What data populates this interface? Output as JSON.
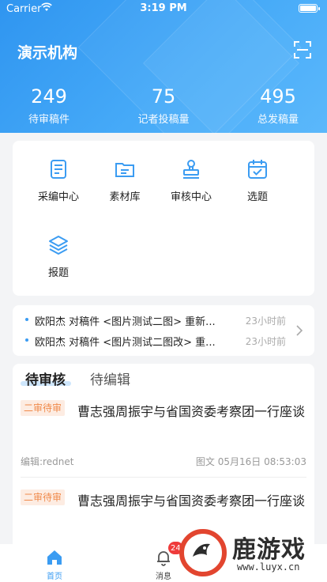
{
  "status_bar": {
    "carrier": "Carrier",
    "time": "3:19 PM"
  },
  "header": {
    "title": "演示机构",
    "stats": [
      {
        "value": "249",
        "label": "待审稿件"
      },
      {
        "value": "75",
        "label": "记者投稿量"
      },
      {
        "value": "495",
        "label": "总发稿量"
      }
    ]
  },
  "menu": [
    {
      "label": "采编中心",
      "icon": "document-icon"
    },
    {
      "label": "素材库",
      "icon": "folder-icon"
    },
    {
      "label": "审核中心",
      "icon": "stamp-icon"
    },
    {
      "label": "选题",
      "icon": "calendar-icon"
    },
    {
      "label": "报题",
      "icon": "layers-icon"
    }
  ],
  "news": [
    {
      "text": "欧阳杰 对稿件 <图片测试二图> 重新...",
      "time": "23小时前"
    },
    {
      "text": "欧阳杰 对稿件 <图片测试二图改> 重...",
      "time": "23小时前"
    }
  ],
  "tabs": {
    "active": "待审核",
    "inactive": "待编辑"
  },
  "items": [
    {
      "badge": "二审待审",
      "title": "曹志强周振宇与省国资委考察团一行座谈",
      "editor": "编辑:rednet",
      "meta": "图文  05月16日 08:53:03"
    },
    {
      "badge": "二审待审",
      "title": "曹志强周振宇与省国资委考察团一行座谈"
    }
  ],
  "tabbar": {
    "home": "首页",
    "messages": "消息",
    "messages_badge": "24"
  },
  "watermark": {
    "name": "鹿游戏",
    "url": "www.luyx.cn"
  },
  "colors": {
    "primary": "#3b9cf2",
    "badge_text": "#f08a4b",
    "badge_bg": "#fdece2",
    "alert": "#ef3b3b"
  }
}
